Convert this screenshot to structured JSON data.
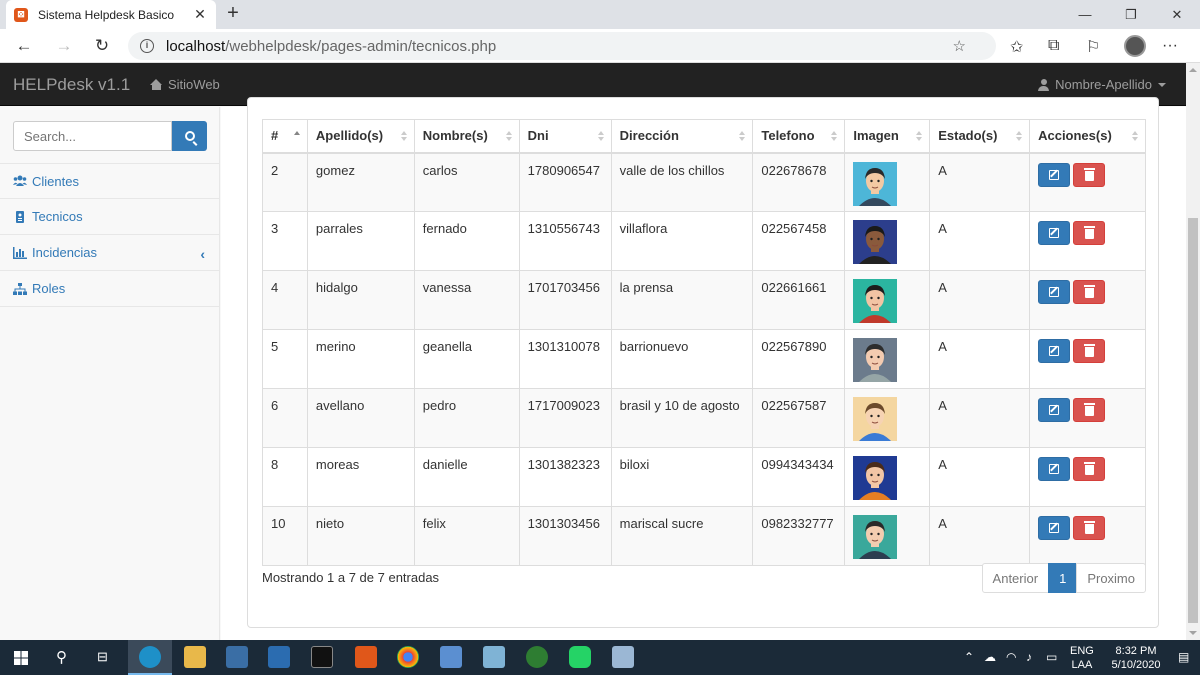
{
  "browser": {
    "tab_title": "Sistema Helpdesk Basico",
    "tab_icon": "xampp-icon",
    "url_host": "localhost",
    "url_path": "/webhelpdesk/pages-admin/tecnicos.php"
  },
  "navbar": {
    "brand": "HELPdesk v1.1",
    "site_link": "SitioWeb",
    "user": "Nombre-Apellido"
  },
  "sidebar": {
    "search_placeholder": "Search...",
    "items": [
      {
        "label": "Clientes",
        "icon": "users-icon"
      },
      {
        "label": "Tecnicos",
        "icon": "id-card-icon"
      },
      {
        "label": "Incidencias",
        "icon": "bar-chart-icon"
      },
      {
        "label": "Roles",
        "icon": "sitemap-icon"
      }
    ]
  },
  "table": {
    "columns": [
      "#",
      "Apellido(s)",
      "Nombre(s)",
      "Dni",
      "Dirección",
      "Telefono",
      "Imagen",
      "Estado(s)",
      "Acciones(s)"
    ],
    "rows": [
      {
        "id": "2",
        "apellido": "gomez",
        "nombre": "carlos",
        "dni": "1780906547",
        "direccion": "valle de los chillos",
        "telefono": "022678678",
        "estado": "A",
        "avatar": {
          "bg": "#4db6d8",
          "skin": "#f3c9a3",
          "hair": "#2a2a2a",
          "shirt": "#34495e"
        }
      },
      {
        "id": "3",
        "apellido": "parrales",
        "nombre": "fernado",
        "dni": "1310556743",
        "direccion": "villaflora",
        "telefono": "022567458",
        "estado": "A",
        "avatar": {
          "bg": "#2c3e8c",
          "skin": "#8a5a3c",
          "hair": "#1a1a1a",
          "shirt": "#222222"
        }
      },
      {
        "id": "4",
        "apellido": "hidalgo",
        "nombre": "vanessa",
        "dni": "1701703456",
        "direccion": "la prensa",
        "telefono": "022661661",
        "estado": "A",
        "avatar": {
          "bg": "#2bb5a0",
          "skin": "#f2c4a4",
          "hair": "#1d1d1d",
          "shirt": "#c0392b"
        }
      },
      {
        "id": "5",
        "apellido": "merino",
        "nombre": "geanella",
        "dni": "1301310078",
        "direccion": "barrionuevo",
        "telefono": "022567890",
        "estado": "A",
        "avatar": {
          "bg": "#6b7b8c",
          "skin": "#f3cbb0",
          "hair": "#2d2d2d",
          "shirt": "#95a5a6"
        }
      },
      {
        "id": "6",
        "apellido": "avellano",
        "nombre": "pedro",
        "dni": "1717009023",
        "direccion": "brasil y 10 de agosto",
        "telefono": "022567587",
        "estado": "A",
        "avatar": {
          "bg": "#f4d6a0",
          "skin": "#f6d3b3",
          "hair": "#6b4a2b",
          "shirt": "#3a7bd5"
        }
      },
      {
        "id": "8",
        "apellido": "moreas",
        "nombre": "danielle",
        "dni": "1301382323",
        "direccion": "biloxi",
        "telefono": "0994343434",
        "estado": "A",
        "avatar": {
          "bg": "#1f3a93",
          "skin": "#f2c6a5",
          "hair": "#4a2b1a",
          "shirt": "#e67e22"
        }
      },
      {
        "id": "10",
        "apellido": "nieto",
        "nombre": "felix",
        "dni": "1301303456",
        "direccion": "mariscal sucre",
        "telefono": "0982332777",
        "estado": "A",
        "avatar": {
          "bg": "#3aa89b",
          "skin": "#f3cdb0",
          "hair": "#2a2a2a",
          "shirt": "#2c3e50"
        }
      }
    ]
  },
  "footer": {
    "info": "Mostrando 1 a 7 de 7 entradas",
    "prev": "Anterior",
    "page": "1",
    "next": "Proximo"
  },
  "taskbar": {
    "lang1": "ENG",
    "lang2": "LAA",
    "time": "8:32 PM",
    "date": "5/10/2020"
  },
  "colors": {
    "primary": "#337ab7",
    "danger": "#d9534f",
    "navbar": "#222222"
  }
}
